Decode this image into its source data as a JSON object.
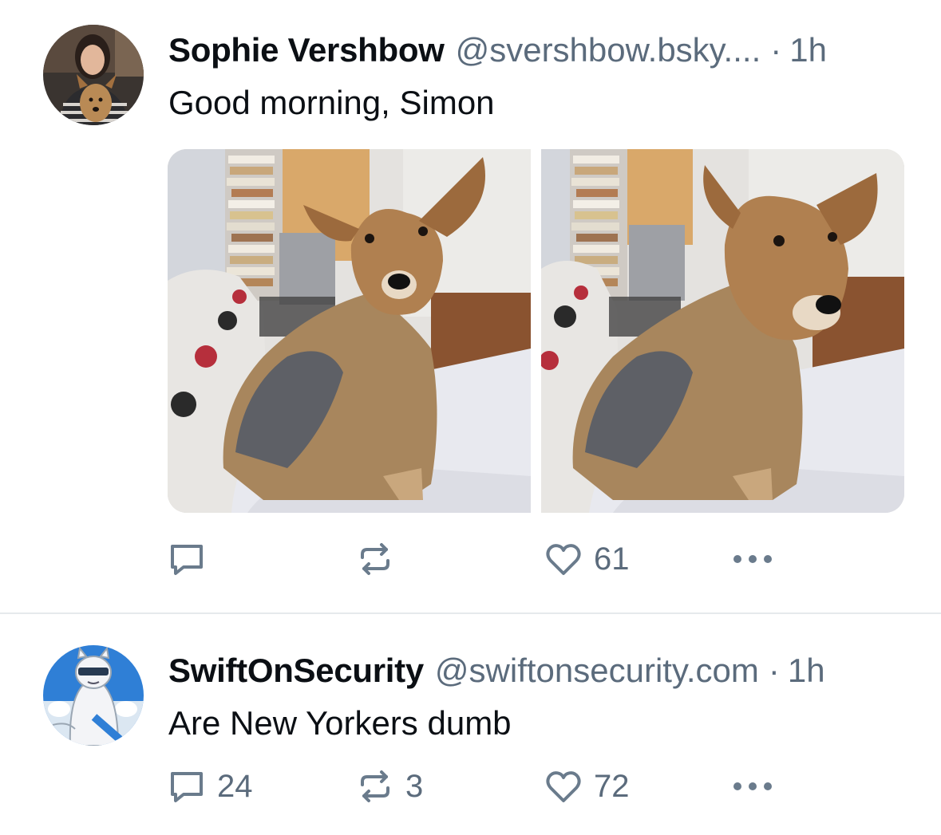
{
  "posts": [
    {
      "author_name": "Sophie Vershbow",
      "handle": "@svershbow.bsky....",
      "separator": "·",
      "time": "1h",
      "text": "Good morning, Simon",
      "reply_count": "",
      "repost_count": "",
      "like_count": "61"
    },
    {
      "author_name": "SwiftOnSecurity",
      "handle": "@swiftonsecurity.com",
      "separator": "·",
      "time": "1h",
      "text": "Are New Yorkers dumb",
      "reply_count": "24",
      "repost_count": "3",
      "like_count": "72"
    }
  ],
  "icons": {
    "reply": "reply-icon",
    "repost": "repost-icon",
    "like": "heart-icon",
    "more": "more-options-icon"
  },
  "colors": {
    "text": "#0b0f14",
    "secondary": "#5b6b7c",
    "icon": "#6a7b8c",
    "divider": "#e6e9ec"
  }
}
